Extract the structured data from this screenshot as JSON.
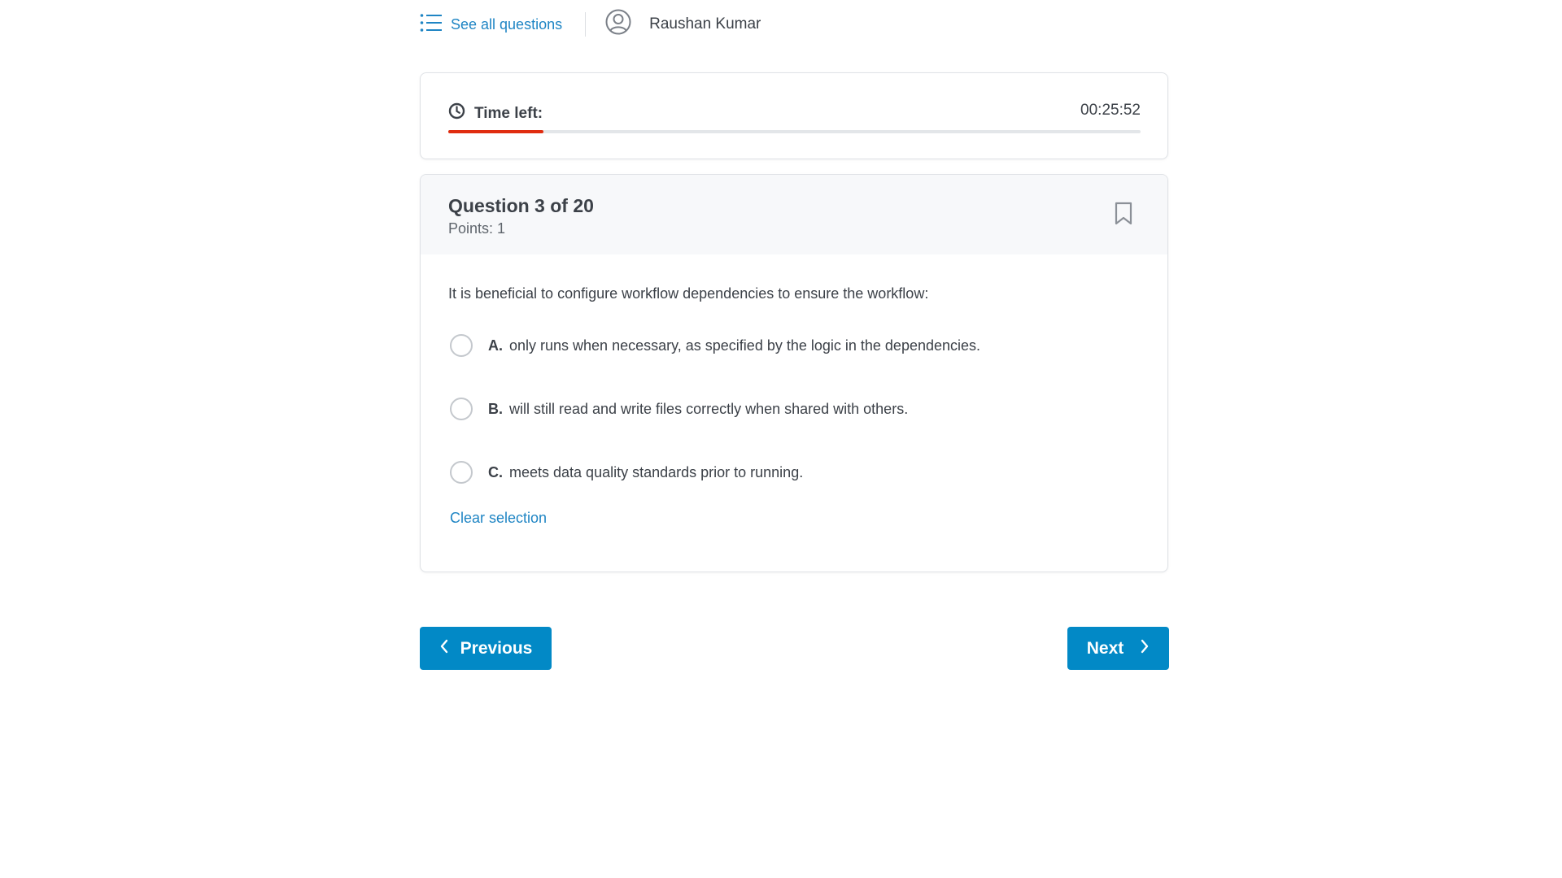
{
  "header": {
    "see_all_label": "See all questions",
    "user_name": "Raushan Kumar",
    "list_icon": "list-icon",
    "user_icon": "user-circle-icon"
  },
  "timer": {
    "label": "Time left:",
    "value": "00:25:52",
    "elapsed_fraction": 0.138,
    "bar_color": "#e02c0f",
    "icon": "clock-icon"
  },
  "question": {
    "title": "Question 3 of 20",
    "points": "Points: 1",
    "text": "It is beneficial to configure workflow dependencies to ensure the workflow:",
    "bookmark_icon": "bookmark-icon",
    "options": [
      {
        "letter": "A.",
        "text": "only runs when necessary, as specified by the logic in the dependencies."
      },
      {
        "letter": "B.",
        "text": "will still read and write files correctly when shared with others."
      },
      {
        "letter": "C.",
        "text": "meets data quality standards prior to running."
      }
    ],
    "clear_label": "Clear selection"
  },
  "nav": {
    "previous_label": "Previous",
    "next_label": "Next",
    "accent": "#0289c6"
  }
}
